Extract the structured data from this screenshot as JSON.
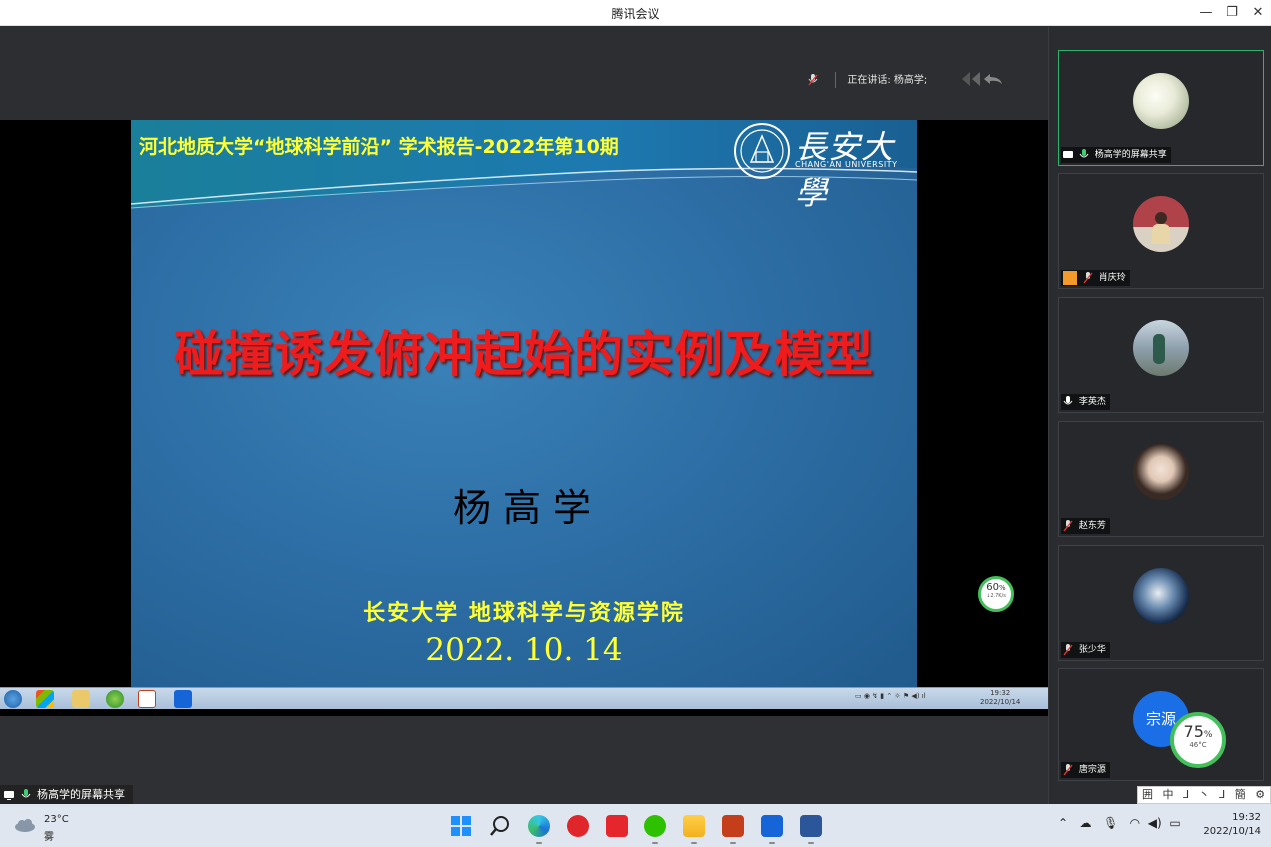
{
  "window": {
    "title": "腾讯会议",
    "minimize": "—",
    "restore": "❐",
    "close": "✕"
  },
  "meeting": {
    "speaking_label": "正在讲话: 杨高学;",
    "share_label": "杨高学的屏幕共享",
    "network_badge": {
      "percent": "60",
      "unit": "%",
      "speed": "↓2.7K/s"
    }
  },
  "slide": {
    "header": "河北地质大学“地球科学前沿” 学术报告-2022年第10期",
    "university_name": "長安大學",
    "university_en": "CHANG'AN UNIVERSITY",
    "title": "碰撞诱发俯冲起始的实例及模型",
    "author": "杨高学",
    "institution": "长安大学  地球科学与资源学院",
    "date": "2022. 10. 14"
  },
  "inner_taskbar": {
    "clock_time": "19:32",
    "clock_date": "2022/10/14"
  },
  "participants": [
    {
      "name": "杨高学的屏幕共享",
      "avatar": "flower-photo",
      "mic": "on",
      "sharing": true,
      "active": true
    },
    {
      "name": "肖庆玲",
      "avatar": "person-photo",
      "mic": "muted",
      "sharing": false
    },
    {
      "name": "李英杰",
      "avatar": "person-outdoor-photo",
      "mic": "on",
      "sharing": false
    },
    {
      "name": "赵东芳",
      "avatar": "anime-portrait",
      "mic": "muted",
      "sharing": false
    },
    {
      "name": "张少华",
      "avatar": "earth-photo",
      "mic": "muted",
      "sharing": false
    },
    {
      "name": "唐宗源",
      "avatar_text": "宗源",
      "mic": "muted",
      "sharing": false
    }
  ],
  "cpu_badge": {
    "percent": "75",
    "unit": "%",
    "temp": "46°C"
  },
  "ime": {
    "text": "囲 中 ⅃ 丶 ⅃ 簡 ⚙ ⋮"
  },
  "taskbar": {
    "weather_temp": "23°C",
    "weather_cond": "雾",
    "clock_time": "19:32",
    "clock_date": "2022/10/14",
    "apps": [
      "start-icon",
      "search-icon",
      "edge-icon",
      "netease-music-icon",
      "youdao-icon",
      "wechat-icon",
      "file-explorer-icon",
      "powerpoint-icon",
      "tencent-meeting-icon",
      "word-icon"
    ]
  },
  "colors": {
    "accent_green": "#2fb36b",
    "slide_yellow": "#ffff33",
    "slide_red": "#ee1c1c"
  }
}
